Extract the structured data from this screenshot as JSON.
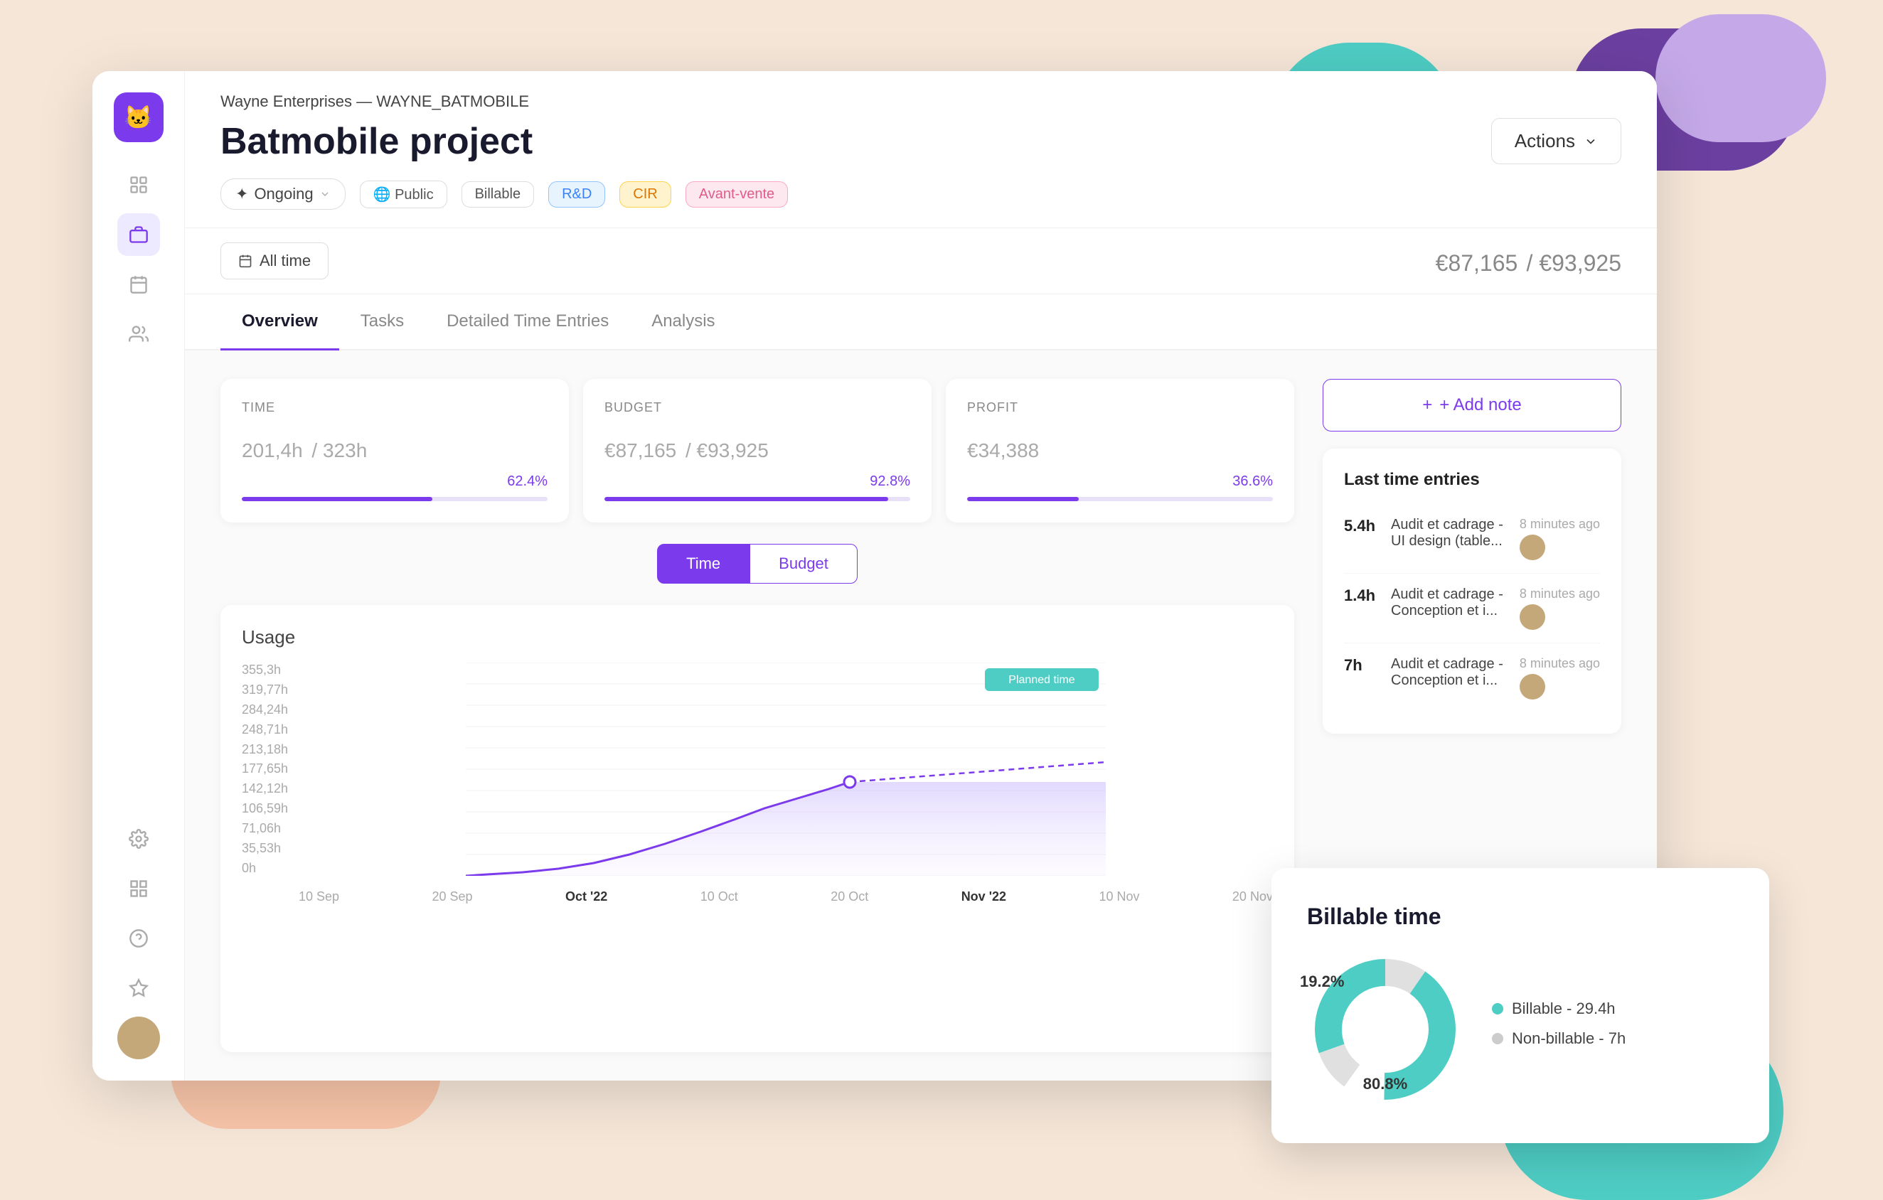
{
  "decorative": {
    "blobs": [
      "orange",
      "peach",
      "teal-top",
      "purple-top",
      "lavender-top",
      "teal-bottom"
    ]
  },
  "sidebar": {
    "logo_icon": "🐱",
    "items": [
      {
        "id": "profile",
        "icon": "👤",
        "active": false
      },
      {
        "id": "briefcase",
        "icon": "💼",
        "active": true
      },
      {
        "id": "calendar",
        "icon": "📅",
        "active": false
      },
      {
        "id": "team",
        "icon": "👥",
        "active": false
      }
    ],
    "bottom_items": [
      {
        "id": "settings",
        "icon": "⚙️",
        "active": false
      },
      {
        "id": "grid",
        "icon": "▦",
        "active": false
      },
      {
        "id": "help",
        "icon": "❓",
        "active": false
      },
      {
        "id": "sparkle",
        "icon": "✨",
        "active": false
      }
    ]
  },
  "header": {
    "breadcrumb_company": "Wayne Enterprises",
    "breadcrumb_separator": " — ",
    "breadcrumb_project": "WAYNE_BATMOBILE",
    "title": "Batmobile project",
    "actions_label": "Actions"
  },
  "status": {
    "ongoing_label": "Ongoing",
    "public_label": "Public",
    "billable_label": "Billable",
    "tags": [
      "R&D",
      "CIR",
      "Avant-vente"
    ]
  },
  "time_filter": {
    "label": "All time",
    "total_spent": "€87,165",
    "total_budget": "/ €93,925"
  },
  "tabs": [
    {
      "id": "overview",
      "label": "Overview",
      "active": true
    },
    {
      "id": "tasks",
      "label": "Tasks",
      "active": false
    },
    {
      "id": "time-entries",
      "label": "Detailed Time Entries",
      "active": false
    },
    {
      "id": "analysis",
      "label": "Analysis",
      "active": false
    }
  ],
  "stats": {
    "time": {
      "label": "TIME",
      "value": "201,4h",
      "denominator": "/ 323h",
      "percent": "62.4%",
      "fill_pct": 62.4
    },
    "budget": {
      "label": "BUDGET",
      "value": "€87,165",
      "denominator": "/ €93,925",
      "percent": "92.8%",
      "fill_pct": 92.8
    },
    "profit": {
      "label": "PROFIT",
      "value": "€34,388",
      "denominator": "",
      "percent": "36.6%",
      "fill_pct": 36.6
    }
  },
  "toggle": {
    "time_label": "Time",
    "budget_label": "Budget",
    "active": "time"
  },
  "chart": {
    "title": "Usage",
    "y_labels": [
      "355,3h",
      "319,77h",
      "284,24h",
      "248,71h",
      "213,18h",
      "177,65h",
      "142,12h",
      "106,59h",
      "71,06h",
      "35,53h",
      "0h"
    ],
    "x_labels": [
      "10 Sep",
      "20 Sep",
      "Oct '22",
      "10 Oct",
      "20 Oct",
      "Nov '22",
      "10 Nov",
      "20 Nov"
    ],
    "planned_label": "Planned time"
  },
  "sidebar_right": {
    "add_note_label": "+ Add note",
    "time_entries_title": "Last time entries",
    "entries": [
      {
        "hours": "5.4h",
        "description": "Audit et cadrage - UI design (table...",
        "time_ago": "8 minutes ago"
      },
      {
        "hours": "1.4h",
        "description": "Audit et cadrage - Conception et i...",
        "time_ago": "8 minutes ago"
      },
      {
        "hours": "7h",
        "description": "Audit et cadrage - Conception et i...",
        "time_ago": "8 minutes ago"
      }
    ]
  },
  "billable_chart": {
    "title": "Billable time",
    "billable_label": "Billable - 29.4h",
    "non_billable_label": "Non-billable - 7h",
    "billable_pct": "80.8%",
    "non_billable_pct": "19.2%",
    "billable_color": "#4ecdc4",
    "non_billable_color": "#cccccc"
  }
}
